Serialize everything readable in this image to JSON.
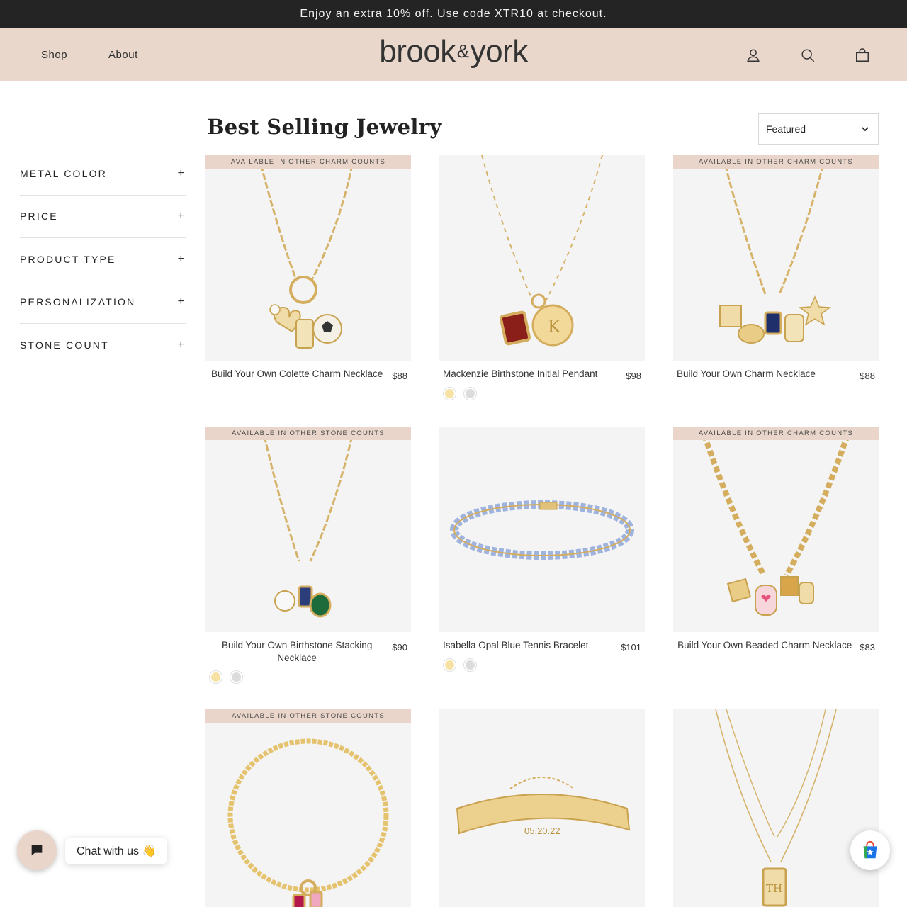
{
  "announcement": "Enjoy an extra 10% off. Use code XTR10 at checkout.",
  "nav": {
    "shop": "Shop",
    "about": "About"
  },
  "logo": {
    "brook": "brook",
    "amp": "&",
    "york": "york"
  },
  "header_icons": [
    "account-icon",
    "search-icon",
    "cart-icon"
  ],
  "page": {
    "title": "Best Selling Jewelry",
    "sort_value": "Featured"
  },
  "filters": [
    "METAL COLOR",
    "PRICE",
    "PRODUCT TYPE",
    "PERSONALIZATION",
    "STONE COUNT"
  ],
  "products": [
    {
      "name": "Build Your Own Colette Charm Necklace",
      "price": "$88",
      "badge": "AVAILABLE IN OTHER CHARM COUNTS",
      "swatches": []
    },
    {
      "name": "Mackenzie Birthstone Initial Pendant",
      "price": "$98",
      "badge": "",
      "swatches": [
        "gold",
        "silver"
      ]
    },
    {
      "name": "Build Your Own Charm Necklace",
      "price": "$88",
      "badge": "AVAILABLE IN OTHER CHARM COUNTS",
      "swatches": []
    },
    {
      "name": "Build Your Own Birthstone Stacking Necklace",
      "price": "$90",
      "badge": "AVAILABLE IN OTHER STONE COUNTS",
      "swatches": [
        "gold",
        "silver"
      ]
    },
    {
      "name": "Isabella Opal Blue Tennis Bracelet",
      "price": "$101",
      "badge": "",
      "swatches": [
        "gold",
        "silver"
      ]
    },
    {
      "name": "Build Your Own Beaded Charm Necklace",
      "price": "$83",
      "badge": "AVAILABLE IN OTHER CHARM COUNTS",
      "swatches": []
    },
    {
      "name": "",
      "price": "",
      "badge": "AVAILABLE IN OTHER STONE COUNTS",
      "swatches": []
    },
    {
      "name": "",
      "price": "",
      "badge": "",
      "swatches": [],
      "engraving": "05.20.22"
    },
    {
      "name": "",
      "price": "",
      "badge": "",
      "swatches": [],
      "engraving": "TH"
    }
  ],
  "colors": {
    "gold_swatch": "#f7e2a6",
    "silver_swatch": "#dcdcdc",
    "accent": "#ead5ca",
    "announce_bg": "#242424"
  },
  "chat": {
    "label": "Chat with us 👋"
  }
}
